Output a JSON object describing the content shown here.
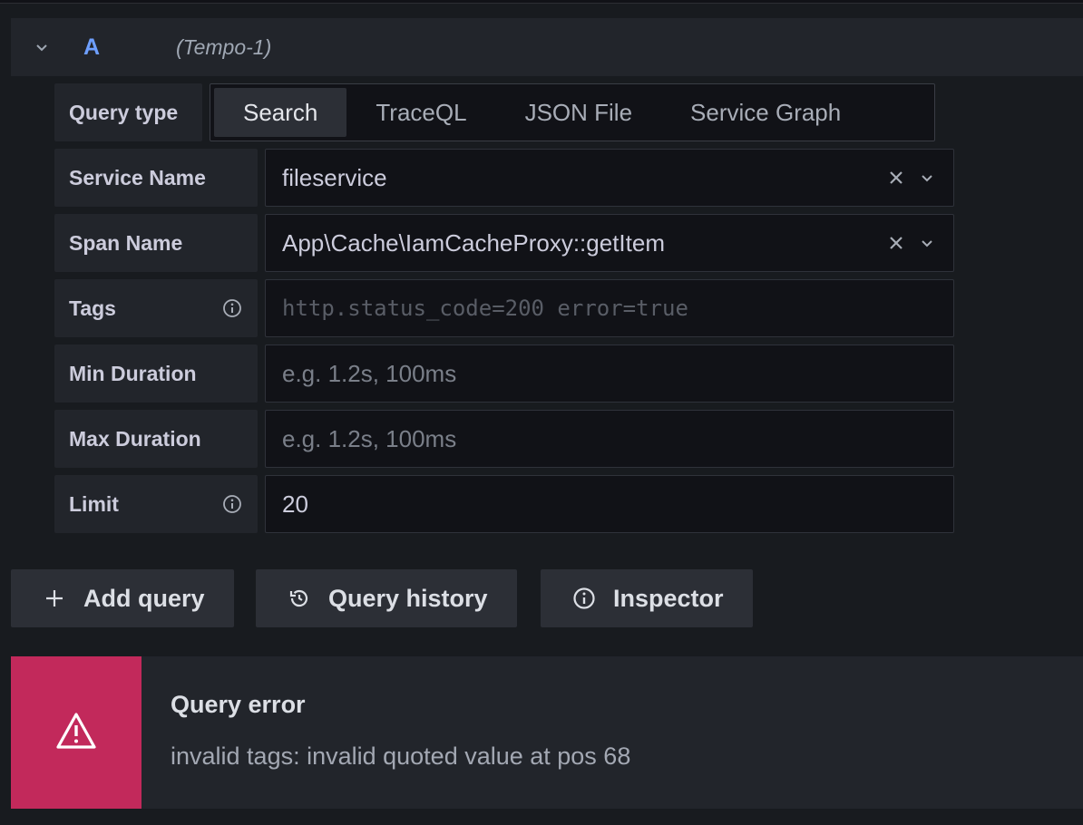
{
  "query": {
    "ref_id": "A",
    "datasource": "(Tempo-1)",
    "query_type": {
      "label": "Query type",
      "options": [
        "Search",
        "TraceQL",
        "JSON File",
        "Service Graph"
      ],
      "selected": "Search"
    },
    "fields": {
      "service_name": {
        "label": "Service Name",
        "value": "fileservice"
      },
      "span_name": {
        "label": "Span Name",
        "value": "App\\Cache\\IamCacheProxy::getItem"
      },
      "tags": {
        "label": "Tags",
        "placeholder": "http.status_code=200 error=true"
      },
      "min_duration": {
        "label": "Min Duration",
        "placeholder": "e.g. 1.2s, 100ms"
      },
      "max_duration": {
        "label": "Max Duration",
        "placeholder": "e.g. 1.2s, 100ms"
      },
      "limit": {
        "label": "Limit",
        "value": "20"
      }
    }
  },
  "actions": {
    "add_query": "Add query",
    "query_history": "Query history",
    "inspector": "Inspector"
  },
  "alert": {
    "title": "Query error",
    "message": "invalid tags: invalid quoted value at pos 68",
    "color": "#c2295b"
  },
  "icons": {
    "collapse": "chevron-down-icon",
    "clear": "close-icon",
    "dropdown": "chevron-down-icon",
    "info": "info-circle-icon",
    "add": "plus-icon",
    "history": "history-icon",
    "inspector": "info-circle-icon",
    "alert": "warning-triangle-icon"
  }
}
